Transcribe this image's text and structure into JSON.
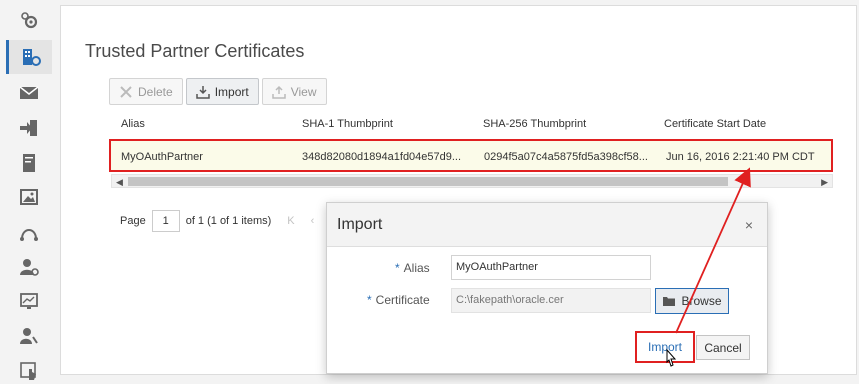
{
  "sidebar": {
    "items": [
      {
        "icon": "gears-icon",
        "active": false
      },
      {
        "icon": "building-gear-icon",
        "active": true
      },
      {
        "icon": "envelope-icon",
        "active": false
      },
      {
        "icon": "sign-in-icon",
        "active": false
      },
      {
        "icon": "document-scroll-icon",
        "active": false
      },
      {
        "icon": "image-icon",
        "active": false
      },
      {
        "icon": "route-icon",
        "active": false
      },
      {
        "icon": "user-gear-icon",
        "active": false
      },
      {
        "icon": "monitor-chart-icon",
        "active": false
      },
      {
        "icon": "user-key-icon",
        "active": false
      },
      {
        "icon": "hand-pointer-icon",
        "active": false
      }
    ]
  },
  "main": {
    "title": "Trusted Partner Certificates",
    "toolbar": {
      "delete_label": "Delete",
      "import_label": "Import",
      "view_label": "View"
    },
    "table": {
      "columns": [
        "Alias",
        "SHA-1 Thumbprint",
        "SHA-256 Thumbprint",
        "Certificate Start Date"
      ],
      "rows": [
        {
          "alias": "MyOAuthPartner",
          "sha1": "348d82080d1894a1fd04e57d9...",
          "sha256": "0294f5a07c4a5875fd5a398cf58...",
          "start_date": "Jun 16, 2016 2:21:40 PM CDT"
        }
      ]
    },
    "pager": {
      "page_label": "Page",
      "page_value": "1",
      "of_text": "of 1 (1 of 1 items)"
    }
  },
  "dialog": {
    "title": "Import",
    "close_glyph": "×",
    "alias_label": "Alias",
    "alias_value": "MyOAuthPartner",
    "certificate_label": "Certificate",
    "certificate_value": "C:\\fakepath\\oracle.cer",
    "browse_label": "Browse",
    "import_label": "Import",
    "cancel_label": "Cancel",
    "required_mark": "*"
  },
  "colors": {
    "accent": "#2a6eb5",
    "highlight": "#e02020",
    "selected_row": "#fbfbe9"
  }
}
